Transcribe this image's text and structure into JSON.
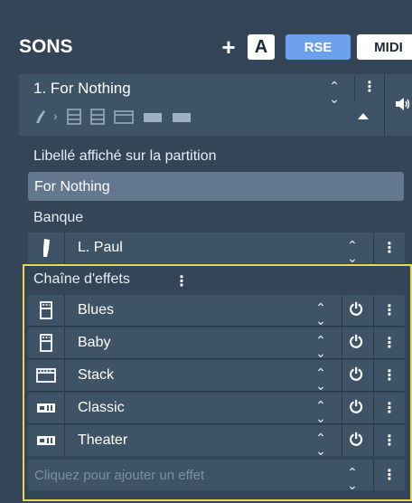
{
  "header": {
    "title": "SONS",
    "add_label": "+",
    "a_label": "A",
    "rse_label": "RSE",
    "midi_label": "MIDI"
  },
  "track": {
    "name": "1. For Nothing",
    "icons": [
      "guitar-icon",
      "amp-stack-icon",
      "amp-stack-icon",
      "cabinet-icon",
      "pedal-icon",
      "pedal-icon"
    ]
  },
  "label_section": {
    "heading": "Libellé affiché sur la partition",
    "value": "For Nothing"
  },
  "bank": {
    "heading": "Banque",
    "value": "L. Paul",
    "icon": "guitar-headstock-icon"
  },
  "effects": {
    "heading": "Chaîne d'effets",
    "items": [
      {
        "label": "Blues",
        "icon": "amp-head-icon"
      },
      {
        "label": "Baby",
        "icon": "amp-head-icon"
      },
      {
        "label": "Stack",
        "icon": "cabinet-icon"
      },
      {
        "label": "Classic",
        "icon": "pedal-icon"
      },
      {
        "label": "Theater",
        "icon": "pedal-icon"
      }
    ],
    "add_placeholder": "Cliquez pour ajouter un effet"
  },
  "colors": {
    "background": "#334557",
    "row": "#3f5366",
    "field": "#63788e",
    "rse": "#6aa0ec",
    "highlight": "#e8d84a"
  }
}
